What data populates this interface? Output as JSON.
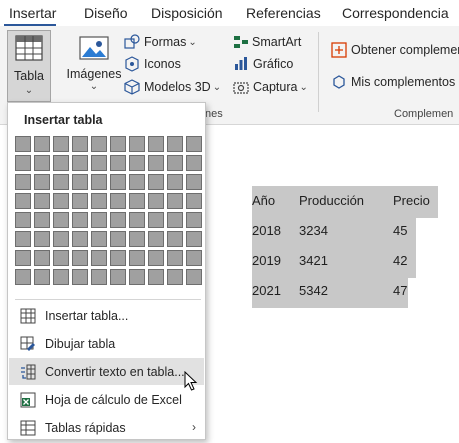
{
  "tabs": [
    {
      "label": "Insertar",
      "active": true
    },
    {
      "label": "Diseño"
    },
    {
      "label": "Disposición"
    },
    {
      "label": "Referencias"
    },
    {
      "label": "Correspondencia"
    }
  ],
  "ribbon": {
    "table_label": "Tabla",
    "images_label": "Imágenes",
    "shapes_label": "Formas",
    "icons_label": "Iconos",
    "models3d_label": "Modelos 3D",
    "smartart_label": "SmartArt",
    "chart_label": "Gráfico",
    "capture_label": "Captura",
    "get_addins_label": "Obtener complemen",
    "my_addins_label": "Mis complementos",
    "group_illustrations_partial": "nes",
    "group_addins": "Complemen"
  },
  "dropdown": {
    "title": "Insertar tabla",
    "grid_rows": 8,
    "grid_cols": 10,
    "items": [
      {
        "label": "Insertar tabla...",
        "icon": "table-grid-icon"
      },
      {
        "label": "Dibujar tabla",
        "icon": "pencil-table-icon"
      },
      {
        "label": "Convertir texto en tabla...",
        "icon": "convert-text-table-icon",
        "hover": true
      },
      {
        "label": "Hoja de cálculo de Excel",
        "icon": "excel-icon"
      },
      {
        "label": "Tablas rápidas",
        "icon": "quick-tables-icon",
        "submenu": true
      }
    ]
  },
  "document_table": {
    "headers": [
      "Año",
      "Producción",
      "Precio"
    ],
    "rows": [
      [
        "2018",
        "3234",
        "45"
      ],
      [
        "2019",
        "3421",
        "42"
      ],
      [
        "2021",
        "5342",
        "47"
      ]
    ]
  },
  "colors": {
    "accent": "#2b579a",
    "excel_green": "#1d6f42",
    "selection": "#c8c8c8"
  }
}
